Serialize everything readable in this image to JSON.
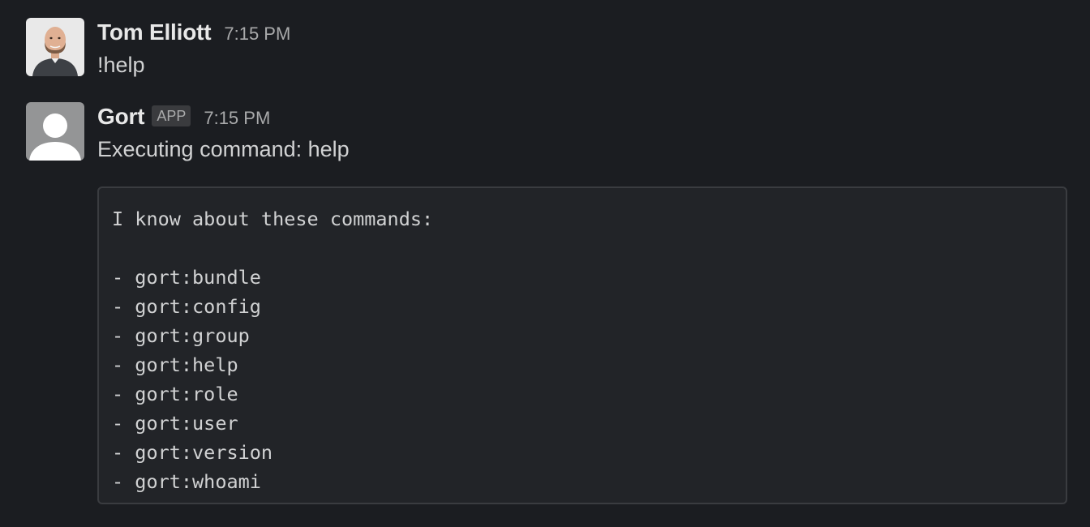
{
  "messages": [
    {
      "sender": "Tom Elliott",
      "time": "7:15 PM",
      "text": "!help",
      "avatar_icon": "user-photo-icon"
    },
    {
      "sender": "Gort",
      "badge": "APP",
      "time": "7:15 PM",
      "text": "Executing command: help",
      "avatar_icon": "default-user-icon",
      "code_block": {
        "intro": "I know about these commands:",
        "lines": [
          "- gort:bundle",
          "- gort:config",
          "- gort:group",
          "- gort:help",
          "- gort:role",
          "- gort:user",
          "- gort:version",
          "- gort:whoami"
        ]
      }
    }
  ],
  "colors": {
    "background": "#1b1d21",
    "code_background": "#222428",
    "code_border": "#3a3c40",
    "text": "#d1d2d3",
    "muted": "#a9aaab"
  }
}
